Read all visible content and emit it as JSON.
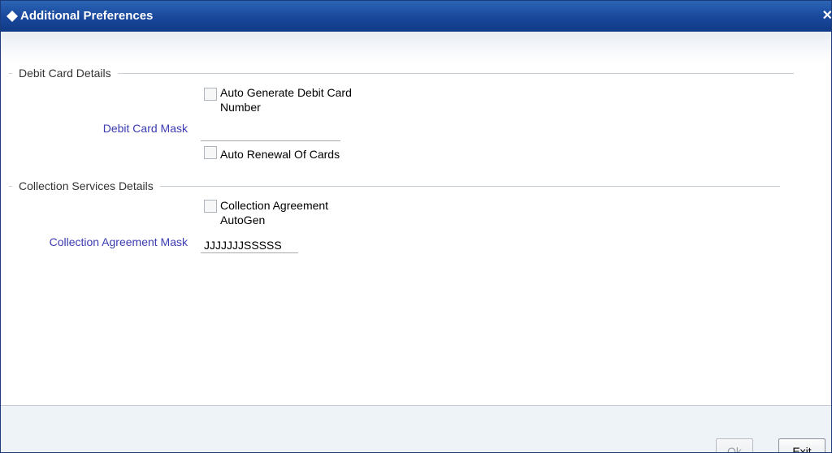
{
  "window": {
    "title": "Additional Preferences",
    "close_glyph": "✕"
  },
  "debit_card": {
    "section_title": "Debit Card Details",
    "auto_generate_label_line1": "Auto Generate Debit Card",
    "auto_generate_label_line2": "Number",
    "auto_generate_checked": false,
    "mask_label": "Debit Card Mask",
    "mask_value": "",
    "auto_renewal_label": "Auto Renewal Of Cards",
    "auto_renewal_checked": false
  },
  "collection": {
    "section_title": "Collection Services Details",
    "autogen_label_line1": "Collection Agreement",
    "autogen_label_line2": "AutoGen",
    "autogen_checked": false,
    "mask_label": "Collection Agreement Mask",
    "mask_value": "JJJJJJJSSSSS"
  },
  "buttons": {
    "ok_label": "Ok",
    "ok_enabled": false,
    "exit_label": "Exit"
  },
  "icons": {
    "title_icon": "diamond-icon",
    "close_icon": "close-icon"
  }
}
